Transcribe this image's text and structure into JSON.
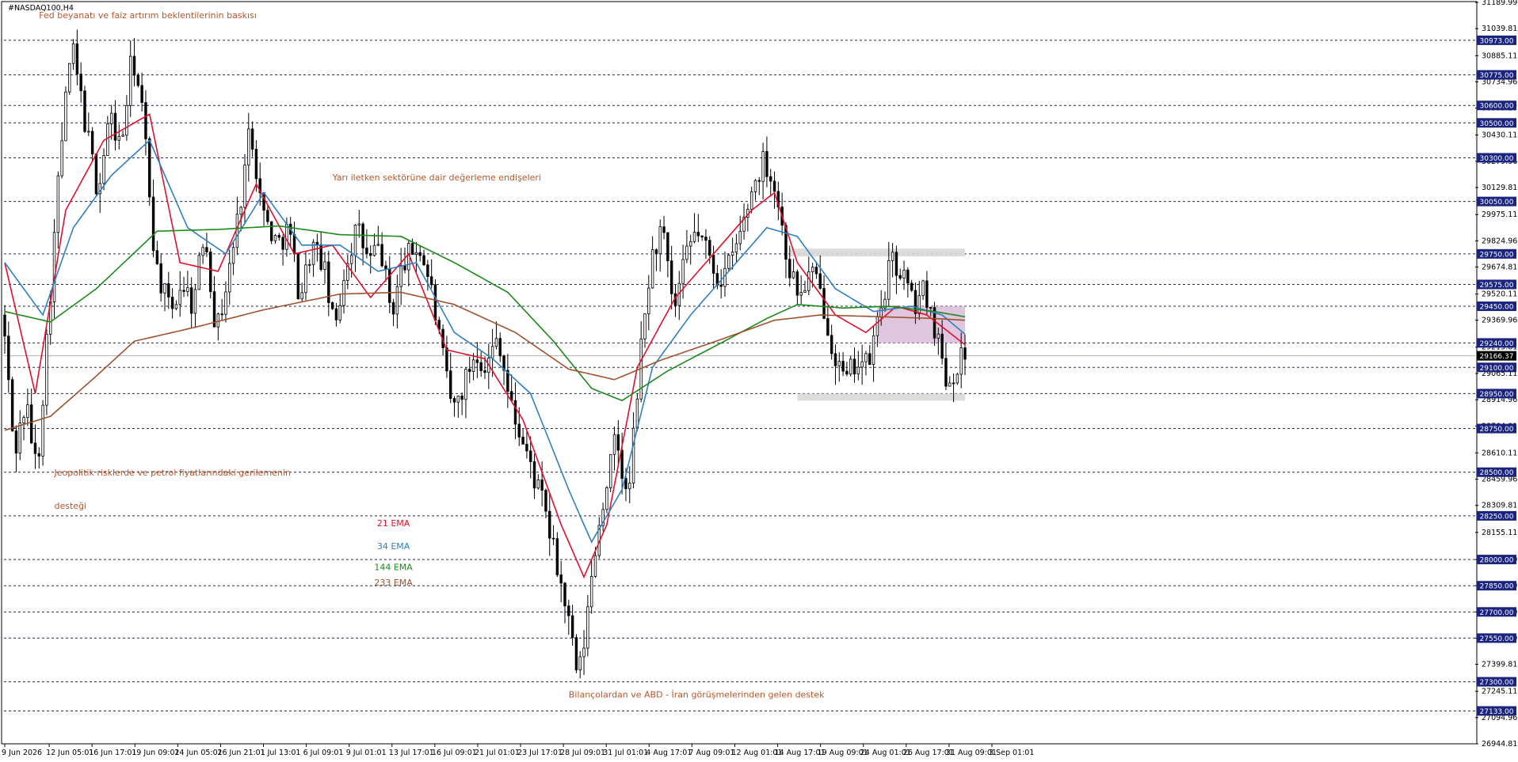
{
  "window": {
    "symbol_title": "#NASDAQ100,H4"
  },
  "colors": {
    "background": "#ffffff",
    "candle": "#000000",
    "grid": "#1f2d6b",
    "ema21": "#e0102a",
    "ema34": "#2f7fc1",
    "ema144": "#1a8a1a",
    "ema233": "#a0522d",
    "note": "#b4572a",
    "level_box": "#1a237e",
    "zone_gray": "#d8d8d8",
    "zone_pink": "#d8b6d6",
    "current_price_box": "#000000"
  },
  "chart_data": {
    "type": "candlestick",
    "symbol": "#NASDAQ100",
    "timeframe": "H4",
    "ylim": [
      26944.81,
      31189.99
    ],
    "current_price": 29166.37,
    "horizontal_levels": [
      30973.0,
      30775.0,
      30600.0,
      30500.0,
      30300.0,
      30050.0,
      29750.0,
      29575.0,
      29450.0,
      29240.0,
      29100.0,
      28950.0,
      28750.0,
      28500.0,
      28250.0,
      28000.0,
      27850.0,
      27700.0,
      27550.0,
      27300.0,
      27133.0
    ],
    "price_ticks": [
      31189.99,
      31039.81,
      30885.11,
      30734.96,
      30585.27,
      30430.11,
      30279.96,
      30129.81,
      29975.11,
      29824.96,
      29674.81,
      29520.11,
      29369.96,
      29215.81,
      29065.11,
      28914.96,
      28764.81,
      28610.11,
      28459.96,
      28309.81,
      28155.11,
      28000.0,
      27850.0,
      27700.0,
      27550.0,
      27399.81,
      27245.11,
      27094.96,
      26944.81
    ],
    "time_labels": [
      "9 Jun 2026",
      "12 Jun 05:01",
      "16 Jun 17:01",
      "19 Jun 09:01",
      "24 Jun 05:01",
      "26 Jun 21:01",
      "1 Jul 13:01",
      "6 Jul 09:01",
      "9 Jul 01:01",
      "13 Jul 17:01",
      "16 Jul 09:01",
      "21 Jul 01:01",
      "23 Jul 17:01",
      "28 Jul 09:01",
      "31 Jul 01:01",
      "4 Aug 17:01",
      "7 Aug 09:01",
      "12 Aug 01:01",
      "14 Aug 17:01",
      "19 Aug 09:01",
      "24 Aug 01:01",
      "26 Aug 17:01",
      "31 Aug 09:01",
      "3 Sep 01:01"
    ],
    "price_path": [
      [
        0,
        29400
      ],
      [
        3,
        28600
      ],
      [
        6,
        28900
      ],
      [
        9,
        28500
      ],
      [
        12,
        29400
      ],
      [
        15,
        30300
      ],
      [
        18,
        30950
      ],
      [
        22,
        30450
      ],
      [
        25,
        30100
      ],
      [
        28,
        30550
      ],
      [
        31,
        30350
      ],
      [
        34,
        30900
      ],
      [
        37,
        30500
      ],
      [
        40,
        29700
      ],
      [
        44,
        29400
      ],
      [
        47,
        29600
      ],
      [
        50,
        29450
      ],
      [
        53,
        29900
      ],
      [
        56,
        29300
      ],
      [
        59,
        29600
      ],
      [
        62,
        30000
      ],
      [
        65,
        30500
      ],
      [
        68,
        30000
      ],
      [
        72,
        29800
      ],
      [
        75,
        29900
      ],
      [
        78,
        29500
      ],
      [
        81,
        29800
      ],
      [
        84,
        29700
      ],
      [
        87,
        29300
      ],
      [
        90,
        29700
      ],
      [
        93,
        29900
      ],
      [
        96,
        29700
      ],
      [
        99,
        29800
      ],
      [
        102,
        29400
      ],
      [
        105,
        29700
      ],
      [
        109,
        29800
      ],
      [
        112,
        29600
      ],
      [
        115,
        29200
      ],
      [
        118,
        28850
      ],
      [
        121,
        29000
      ],
      [
        124,
        29200
      ],
      [
        127,
        29100
      ],
      [
        130,
        29300
      ],
      [
        133,
        28900
      ],
      [
        136,
        28700
      ],
      [
        139,
        28500
      ],
      [
        142,
        28300
      ],
      [
        145,
        28000
      ],
      [
        148,
        27700
      ],
      [
        151,
        27300
      ],
      [
        153,
        27600
      ],
      [
        155,
        28000
      ],
      [
        158,
        28400
      ],
      [
        161,
        28700
      ],
      [
        164,
        28300
      ],
      [
        167,
        29100
      ],
      [
        170,
        29700
      ],
      [
        173,
        29900
      ],
      [
        176,
        29400
      ],
      [
        179,
        29700
      ],
      [
        182,
        29900
      ],
      [
        185,
        29750
      ],
      [
        188,
        29600
      ],
      [
        191,
        29700
      ],
      [
        194,
        29900
      ],
      [
        197,
        30150
      ],
      [
        200,
        30300
      ],
      [
        203,
        30100
      ],
      [
        206,
        29700
      ],
      [
        209,
        29500
      ],
      [
        212,
        29650
      ],
      [
        215,
        29500
      ],
      [
        218,
        29200
      ],
      [
        221,
        29000
      ],
      [
        224,
        29150
      ],
      [
        227,
        29100
      ],
      [
        230,
        29400
      ],
      [
        233,
        29700
      ],
      [
        236,
        29650
      ],
      [
        239,
        29450
      ],
      [
        242,
        29550
      ],
      [
        245,
        29300
      ],
      [
        248,
        29000
      ],
      [
        251,
        29150
      ],
      [
        253,
        29166
      ]
    ],
    "bar_count": 253,
    "ema_series": [
      {
        "period": 21,
        "values": [
          [
            0,
            29700
          ],
          [
            8,
            28950
          ],
          [
            16,
            30000
          ],
          [
            26,
            30400
          ],
          [
            38,
            30550
          ],
          [
            46,
            29700
          ],
          [
            56,
            29650
          ],
          [
            66,
            30150
          ],
          [
            76,
            29750
          ],
          [
            86,
            29800
          ],
          [
            96,
            29500
          ],
          [
            106,
            29750
          ],
          [
            116,
            29200
          ],
          [
            126,
            29150
          ],
          [
            136,
            28800
          ],
          [
            146,
            28200
          ],
          [
            152,
            27900
          ],
          [
            158,
            28200
          ],
          [
            166,
            29100
          ],
          [
            176,
            29500
          ],
          [
            186,
            29750
          ],
          [
            196,
            30000
          ],
          [
            202,
            30100
          ],
          [
            208,
            29700
          ],
          [
            218,
            29400
          ],
          [
            226,
            29300
          ],
          [
            234,
            29450
          ],
          [
            242,
            29400
          ],
          [
            252,
            29230
          ]
        ]
      },
      {
        "period": 34,
        "values": [
          [
            0,
            29700
          ],
          [
            10,
            29400
          ],
          [
            18,
            29900
          ],
          [
            28,
            30200
          ],
          [
            38,
            30400
          ],
          [
            48,
            29900
          ],
          [
            58,
            29750
          ],
          [
            68,
            30100
          ],
          [
            78,
            29800
          ],
          [
            88,
            29800
          ],
          [
            98,
            29650
          ],
          [
            108,
            29700
          ],
          [
            118,
            29300
          ],
          [
            128,
            29150
          ],
          [
            138,
            28950
          ],
          [
            148,
            28400
          ],
          [
            154,
            28100
          ],
          [
            162,
            28400
          ],
          [
            170,
            29100
          ],
          [
            180,
            29400
          ],
          [
            190,
            29650
          ],
          [
            200,
            29900
          ],
          [
            208,
            29850
          ],
          [
            218,
            29550
          ],
          [
            228,
            29420
          ],
          [
            238,
            29450
          ],
          [
            246,
            29400
          ],
          [
            252,
            29290
          ]
        ]
      },
      {
        "period": 144,
        "values": [
          [
            0,
            29420
          ],
          [
            12,
            29360
          ],
          [
            24,
            29550
          ],
          [
            40,
            29880
          ],
          [
            56,
            29890
          ],
          [
            72,
            29910
          ],
          [
            88,
            29860
          ],
          [
            104,
            29850
          ],
          [
            118,
            29700
          ],
          [
            132,
            29530
          ],
          [
            144,
            29250
          ],
          [
            154,
            28980
          ],
          [
            162,
            28910
          ],
          [
            174,
            29080
          ],
          [
            188,
            29240
          ],
          [
            200,
            29380
          ],
          [
            208,
            29460
          ],
          [
            220,
            29440
          ],
          [
            232,
            29450
          ],
          [
            244,
            29420
          ],
          [
            252,
            29390
          ]
        ]
      },
      {
        "period": 233,
        "values": [
          [
            0,
            28740
          ],
          [
            12,
            28820
          ],
          [
            24,
            29050
          ],
          [
            34,
            29250
          ],
          [
            50,
            29330
          ],
          [
            68,
            29430
          ],
          [
            88,
            29520
          ],
          [
            104,
            29530
          ],
          [
            118,
            29460
          ],
          [
            134,
            29300
          ],
          [
            148,
            29090
          ],
          [
            160,
            29030
          ],
          [
            172,
            29140
          ],
          [
            188,
            29260
          ],
          [
            202,
            29370
          ],
          [
            214,
            29400
          ],
          [
            230,
            29390
          ],
          [
            244,
            29380
          ],
          [
            252,
            29370
          ]
        ]
      }
    ],
    "zones": [
      {
        "from_bar": 206,
        "to_bar": 252,
        "top": 29780,
        "bottom": 29735,
        "kind": "gray"
      },
      {
        "from_bar": 208,
        "to_bar": 252,
        "top": 28950,
        "bottom": 28910,
        "kind": "gray"
      },
      {
        "from_bar": 229,
        "to_bar": 252,
        "top": 29450,
        "bottom": 29240,
        "kind": "pink"
      }
    ],
    "annotations": [
      {
        "text": "Fed beyanatı ve faiz artırım beklentilerinin baskısı",
        "bar": 9,
        "price": 31100
      },
      {
        "text": "Yarı iletken sektörüne dair değerleme endişeleri",
        "bar": 86,
        "price": 30170
      },
      {
        "text": "Jeopolitik risklerde ve petrol fiyatlarındaki gerilemenin",
        "bar": 13,
        "price": 28480
      },
      {
        "text": "desteği",
        "bar": 13,
        "price": 28290
      },
      {
        "text": "Bilançolardan ve ABD - İran görüşmelerinden gelen destek",
        "bar": 148,
        "price": 27210
      }
    ],
    "ema_legend": [
      {
        "label": "21 EMA",
        "bar": 102,
        "price": 28190
      },
      {
        "label": "34 EMA",
        "bar": 102,
        "price": 28060
      },
      {
        "label": "144 EMA",
        "bar": 102,
        "price": 27940
      },
      {
        "label": "233 EMA",
        "bar": 102,
        "price": 27850
      }
    ]
  }
}
